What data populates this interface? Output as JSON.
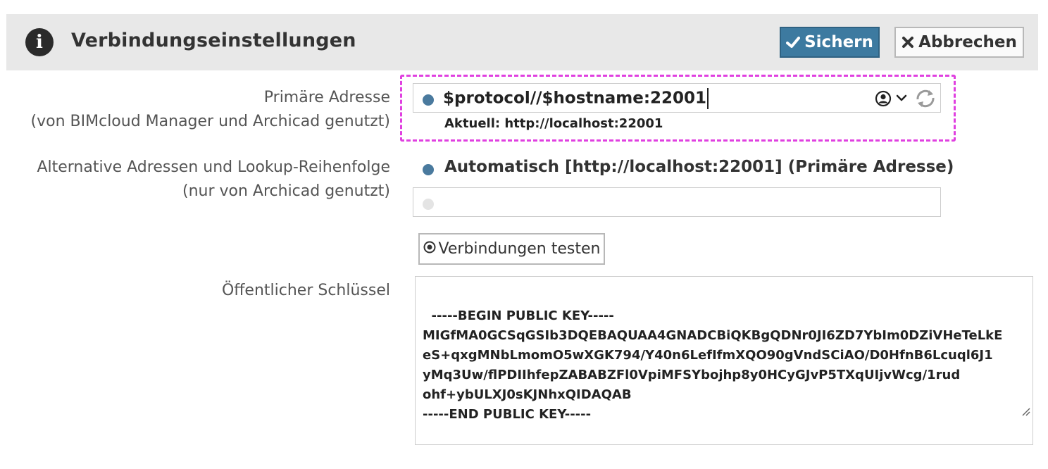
{
  "header": {
    "title": "Verbindungseinstellungen",
    "save_label": "Sichern",
    "cancel_label": "Abbrechen",
    "accent_color": "#3d7aa0"
  },
  "primary": {
    "label_line1": "Primäre Adresse",
    "label_line2": "(von BIMcloud Manager und Archicad genutzt)",
    "value": "$protocol//$hostname:22001",
    "current": "Aktuell: http://localhost:22001"
  },
  "alternative": {
    "label_line1": "Alternative Adressen und Lookup-Reihenfolge",
    "label_line2": "(nur von Archicad genutzt)",
    "automatic": "Automatisch [http://localhost:22001] (Primäre Adresse)",
    "input_value": ""
  },
  "test_button": {
    "label": "Verbindungen testen"
  },
  "public_key": {
    "label": "Öffentlicher Schlüssel",
    "value": "-----BEGIN PUBLIC KEY-----\nMIGfMA0GCSqGSIb3DQEBAQUAA4GNADCBiQKBgQDNr0JI6ZD7YbIm0DZiVHeTeLkE\neS+qxgMNbLmomO5wXGK794/Y40n6LefIfmXQO90gVndSCiAO/D0HfnB6Lcuql6J1\nyMq3Uw/flPDIIhfepZABABZFl0VpiMFSYbojhp8y0HCyGJvP5TXqUIjvWcg/1rud\nohf+ybULXJ0sKJNhxQIDAQAB\n-----END PUBLIC KEY-----"
  },
  "icons": {
    "info": "info-icon",
    "save": "checkmark-icon",
    "cancel": "close-icon",
    "user": "user-circle-icon",
    "chevron": "chevron-down-icon",
    "refresh": "refresh-icon",
    "test": "radio-target-icon"
  }
}
